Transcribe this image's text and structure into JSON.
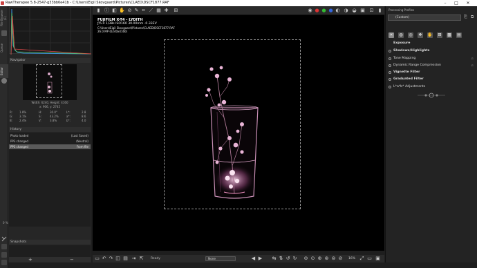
{
  "window": {
    "title": "RawTherapee 5.8-2547-g33bb6e41b - C:\\Users\\Eigil Skovgaard\\Pictures\\CLAED\\DSCF1877.RAF",
    "minimize": "–",
    "maximize": "□",
    "close": "✕"
  },
  "left_strip": {
    "tabs": [
      "File Browser (F)",
      "Queue",
      "Editor"
    ]
  },
  "navigator": {
    "header": "Navigator",
    "size_text": "Width: 6240, Height: 4160",
    "coords": "x: 906, y: 2745",
    "readouts": [
      {
        "l1": "R:",
        "v1": "1.8%",
        "l2": "H:",
        "v2": "30.0°",
        "l3": "L*:",
        "v3": "2.8"
      },
      {
        "l1": "G:",
        "v1": "3.1%",
        "l2": "S:",
        "v2": "43.2%",
        "l3": "a*:",
        "v3": "8.6"
      },
      {
        "l1": "B:",
        "v1": "2.4%",
        "l2": "V:",
        "v2": "3.8%",
        "l3": "b*:",
        "v3": "4.0"
      }
    ]
  },
  "history": {
    "header": "History",
    "items": [
      {
        "label": "Photo loaded",
        "value": "(Last Saved)",
        "selected": false
      },
      {
        "label": "PP3 changed",
        "value": "(Neutral)",
        "selected": false
      },
      {
        "label": "PP3 changed",
        "value": "From file",
        "selected": true
      }
    ],
    "zoom_pct": "0 %"
  },
  "snapshots": {
    "header": "Snapshots",
    "add": "+",
    "remove": "−"
  },
  "image_info": {
    "camera": "FUJIFILM X-T4 - LYDITH",
    "exposure": "ƒ/5.0  1/38s  ISO160  30.00mm  -0.33EV",
    "path": "C:\\Users\\Eigil Skovgaard\\Pictures\\CLAED\\DSCF1877.RAF",
    "mp": "26.0 MP (6240x4160)"
  },
  "statusbar": {
    "ready": "Ready",
    "preview_mode": "None",
    "zoom": "16%"
  },
  "profiles": {
    "header": "Processing Profiles",
    "selected": "(Custom)"
  },
  "tools": [
    {
      "label": "Exposure",
      "bold": true,
      "indicator": false
    },
    {
      "label": "Shadows/Highlights",
      "bold": true,
      "indicator": true
    },
    {
      "label": "Tone Mapping",
      "bold": false,
      "indicator": true
    },
    {
      "label": "Dynamic Range Compression",
      "bold": false,
      "indicator": true
    },
    {
      "label": "Vignette Filter",
      "bold": true,
      "indicator": true
    },
    {
      "label": "Graduated Filter",
      "bold": true,
      "indicator": true
    },
    {
      "label": "L*a*b* Adjustments",
      "bold": false,
      "indicator": true
    }
  ],
  "colors": {
    "bg": "#1e1e1e",
    "panel": "#262626",
    "selected_row": "#5a5a5a",
    "flower_pink": "#e9b4d6"
  }
}
